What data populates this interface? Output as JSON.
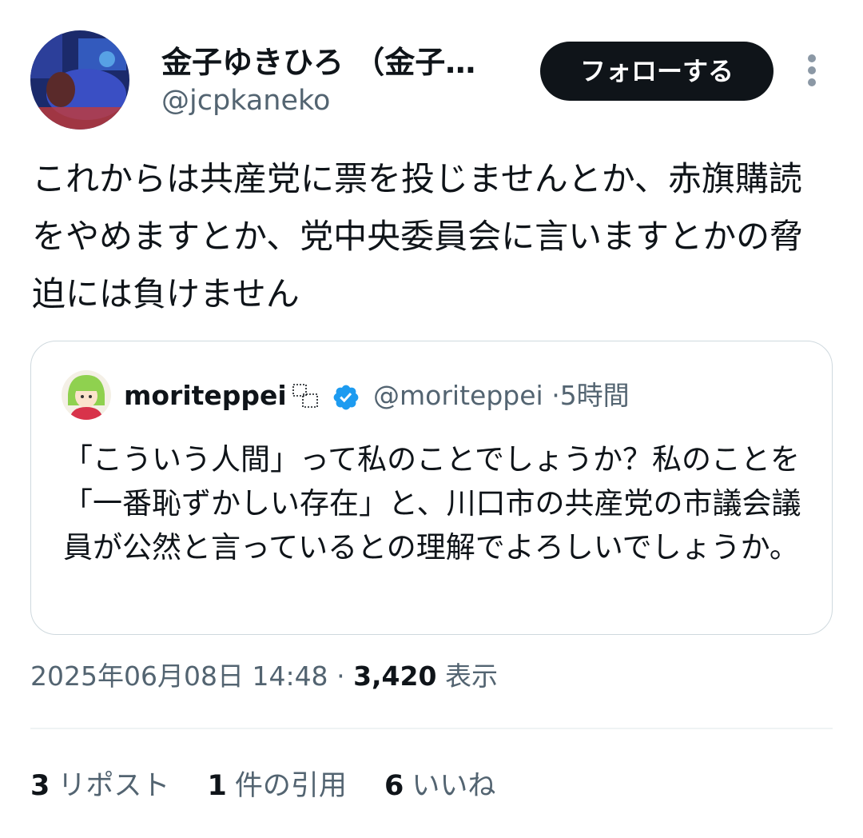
{
  "author": {
    "display_name": "金子ゆきひろ （金子…",
    "handle": "@jcpkaneko"
  },
  "follow_button_label": "フォローする",
  "tweet_text": "これからは共産党に票を投じませんとか、赤旗購読をやめますとか、党中央委員会に言いますとかの脅迫には負けません",
  "quoted_tweet": {
    "display_name": "moriteppei",
    "handle": "@moriteppei",
    "separator": "·",
    "time": "5時間",
    "text": "「こういう人間」って私のことでしょうか？私のことを「一番恥ずかしい存在」と、川口市の共産党の市議会議員が公然と言っているとの理解でよろしいでしょうか。"
  },
  "meta": {
    "datetime": "2025年06月08日 14:48",
    "separator": "·",
    "views_count": "3,420",
    "views_label": "表示"
  },
  "stats": [
    {
      "count": "3",
      "label": "リポスト"
    },
    {
      "count": "1",
      "label": "件の引用"
    },
    {
      "count": "6",
      "label": "いいね"
    }
  ],
  "colors": {
    "text_primary": "#0f1419",
    "text_secondary": "#536471",
    "verified": "#1d9bf0",
    "button_bg": "#0f1419"
  },
  "icons": [
    "more-icon",
    "verified-badge-icon",
    "emoji-placeholder-icon"
  ]
}
